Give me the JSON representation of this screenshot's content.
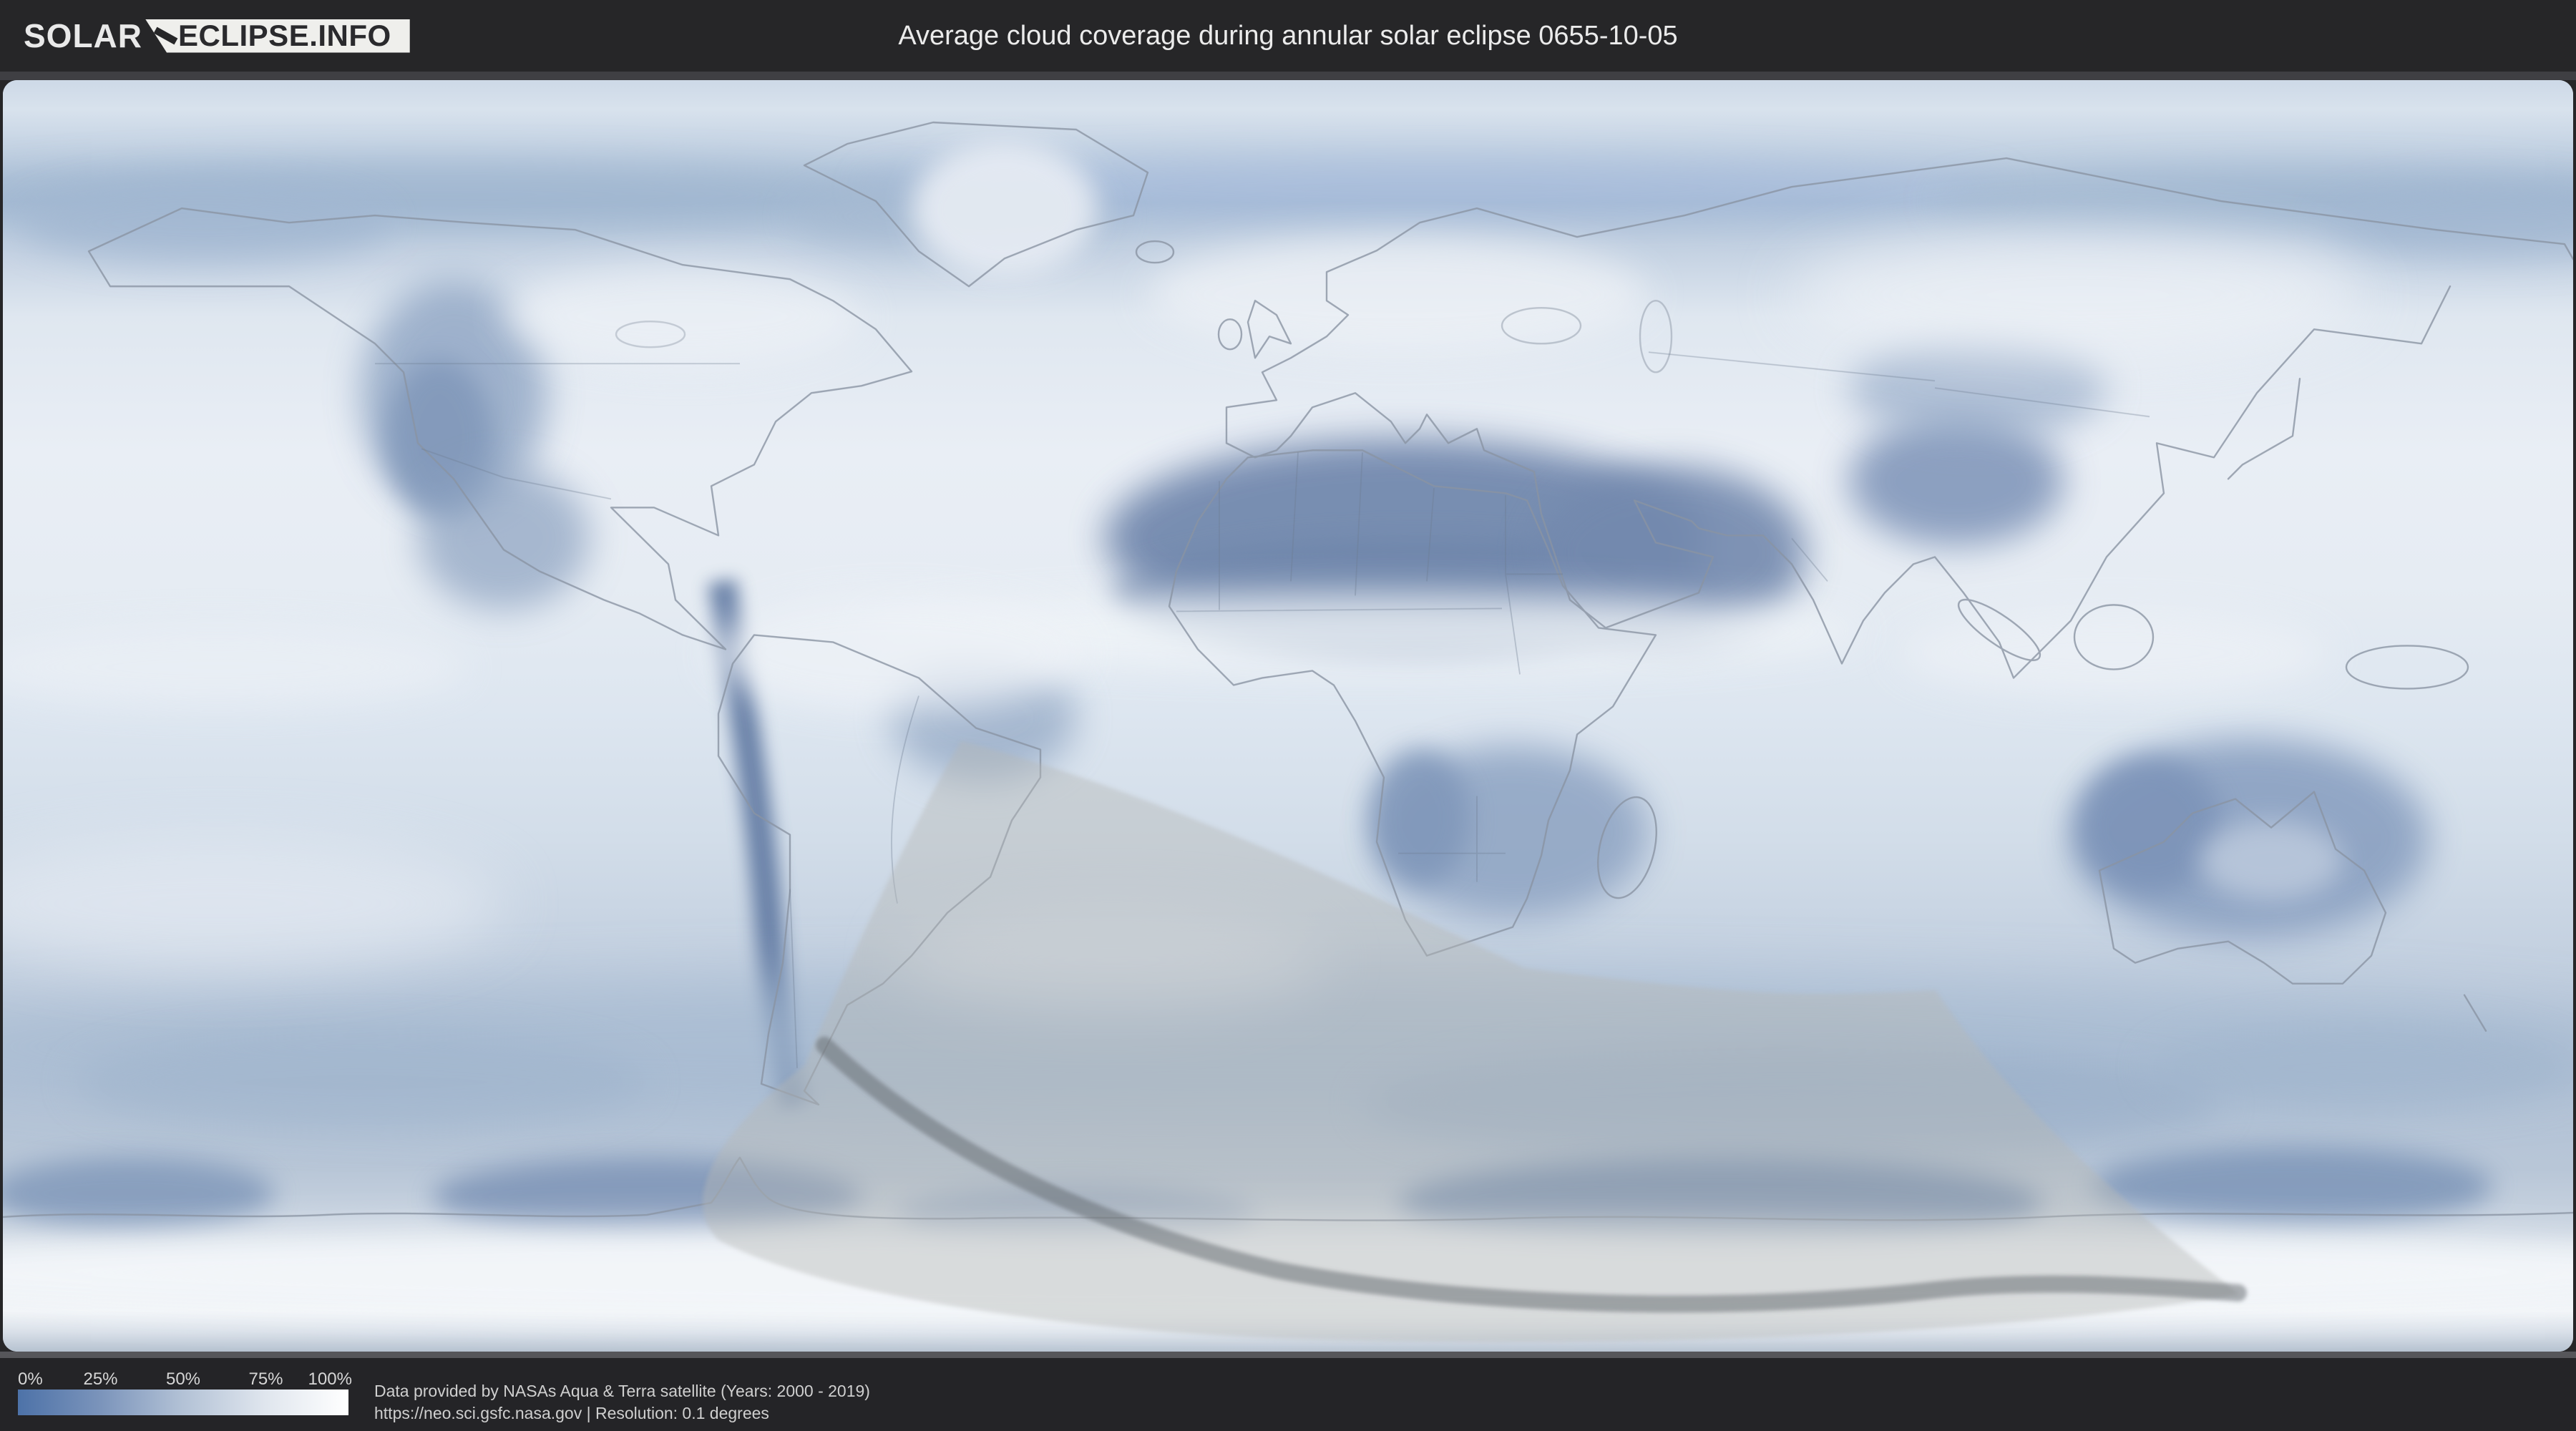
{
  "header": {
    "logo": {
      "part1": "SOLAR",
      "part2": "ECLIPSE.INFO"
    },
    "title": "Average cloud coverage during annular solar eclipse 0655-10-05"
  },
  "legend": {
    "ticks": [
      "0%",
      "25%",
      "50%",
      "75%",
      "100%"
    ],
    "gradient_start": "#4d72a8",
    "gradient_end": "#ffffff"
  },
  "attribution": {
    "line1": "Data provided by NASAs Aqua & Terra satellite (Years: 2000 - 2019)",
    "line2": "https://neo.sci.gsfc.nasa.gov | Resolution: 0.1 degrees"
  },
  "map": {
    "description": "World cloud coverage map (equirectangular) with annular eclipse visibility band and central eclipse path",
    "colors": {
      "page_background": "#262628",
      "header_text": "#ebebeb",
      "badge_background": "#efefec",
      "badge_text": "#2a2a2d",
      "frame_top": "#3f3f43",
      "frame_bottom": "#56565a",
      "low_cloud_dark_blue": "#7389ae",
      "high_cloud_white": "#f3f6f9",
      "coastline": "#8a94a3",
      "eclipse_band_fill": "rgba(182,183,180,0.42)",
      "eclipse_center_line": "rgba(96,101,107,0.5)"
    }
  }
}
